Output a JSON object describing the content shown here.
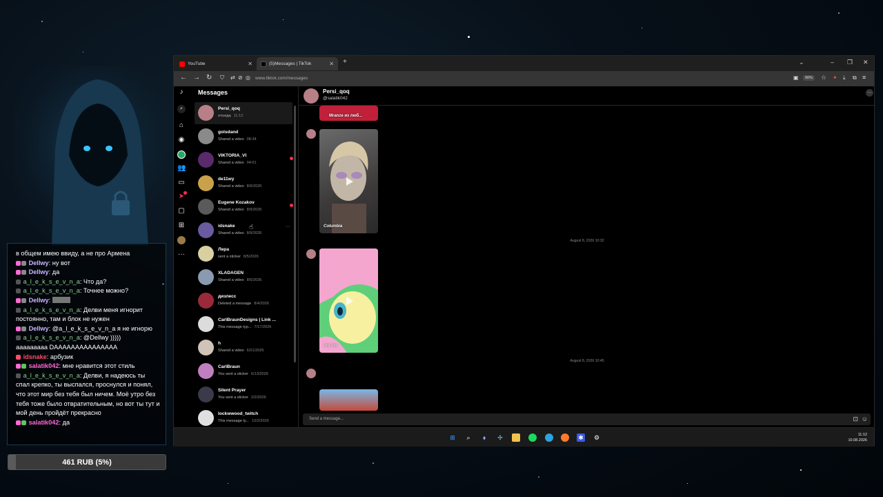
{
  "chat_overlay": {
    "messages": [
      {
        "user": "",
        "text": "в общем имею ввиду, а не про Армена",
        "color": "#ffffff"
      },
      {
        "user": "Dellwy",
        "text": "ну вот",
        "color": "#c9b6ff"
      },
      {
        "user": "Dellwy",
        "text": "да",
        "color": "#c9b6ff"
      },
      {
        "user": "a_l_e_k_s_e_v_n_a",
        "text": "Что да?",
        "color": "#8fd18f"
      },
      {
        "user": "a_l_e_k_s_e_v_n_a",
        "text": "Точнее можно?",
        "color": "#8fd18f"
      },
      {
        "user": "Dellwy",
        "text": "",
        "color": "#c9b6ff"
      },
      {
        "user": "a_l_e_k_s_e_v_n_a",
        "text": "Делви меня игнорит постоянно, там и блок не нужен",
        "color": "#8fd18f"
      },
      {
        "user": "Dellwy",
        "text": "@a_l_e_k_s_e_v_n_a я не игнорю",
        "color": "#c9b6ff"
      },
      {
        "user": "a_l_e_k_s_e_v_n_a",
        "text": "@Dellwy )))))",
        "color": "#8fd18f"
      },
      {
        "user": "",
        "text": "ааааааааа DAAAAAAAAAAAAAAA",
        "color": "#ffffff"
      },
      {
        "user": "idsnake",
        "text": "арбузик",
        "color": "#ff4d6a"
      },
      {
        "user": "salatik042",
        "text": "мне нравится этот стиль",
        "color": "#ff6ad5"
      },
      {
        "user": "a_l_e_k_s_e_v_n_a",
        "text": "Делви, я надеюсь ты спал крепко, ты выспался, проснулся и понял, что этот мир без тебя был ничем. Моё утро без тебя тоже было отвратительным, но вот ты тут и мой день пройдёт прекрасно",
        "color": "#8fd18f"
      },
      {
        "user": "salatik042",
        "text": "да",
        "color": "#ff6ad5"
      }
    ]
  },
  "donation": {
    "label": "461 RUB (5%)",
    "progress_percent": 5
  },
  "browser": {
    "tabs": [
      {
        "label": "YouTube",
        "favicon_color": "#ff0000",
        "active": false
      },
      {
        "label": "(5)Messages | TikTok",
        "favicon_color": "#000000",
        "active": true
      }
    ],
    "new_tab": "+",
    "url": "www.tiktok.com/messages",
    "zoom": "90%",
    "window_controls": {
      "minimize": "–",
      "maximize": "❐",
      "close": "✕"
    }
  },
  "tiktok": {
    "messages_title": "Messages",
    "conversations": [
      {
        "name": "Persi_qoq",
        "preview": "отсюда",
        "time": "11:12",
        "avatar_color": "#b77f86",
        "active": true,
        "unread": false
      },
      {
        "name": "golsdand",
        "preview": "Shared a video",
        "time": "08:34",
        "avatar_color": "#8a8a8a",
        "active": false,
        "unread": false
      },
      {
        "name": "VIKTORIA_VI",
        "preview": "Shared a video",
        "time": "04:01",
        "avatar_color": "#5a2a6a",
        "active": false,
        "unread": true
      },
      {
        "name": "de11wy",
        "preview": "Shared a video",
        "time": "8/9/2026",
        "avatar_color": "#c9a14a",
        "active": false,
        "unread": false
      },
      {
        "name": "Eugene Kozakov",
        "preview": "Shared a video",
        "time": "8/9/2026",
        "avatar_color": "#5a5a5a",
        "active": false,
        "unread": true
      },
      {
        "name": "idsnake",
        "preview": "Shared a video",
        "time": "8/9/2026",
        "avatar_color": "#6a5aa0",
        "active": false,
        "unread": false
      },
      {
        "name": "Лера",
        "preview": "sent a sticker",
        "time": "8/5/2026",
        "avatar_color": "#d8d0a0",
        "active": false,
        "unread": false
      },
      {
        "name": "XLADAGEN",
        "preview": "Shared a video",
        "time": "8/5/2026",
        "avatar_color": "#8a9ab0",
        "active": false,
        "unread": false
      },
      {
        "name": "дизлесс",
        "preview": "Deleted a message",
        "time": "8/4/2026",
        "avatar_color": "#9a2a3a",
        "active": false,
        "unread": false
      },
      {
        "name": "CarlBraunDesigns | Link ...",
        "preview": "This message typ...",
        "time": "7/17/2026",
        "avatar_color": "#dcdcdc",
        "active": false,
        "unread": false
      },
      {
        "name": "h",
        "preview": "Shared a video",
        "time": "6/21/2026",
        "avatar_color": "#d0c4b8",
        "active": false,
        "unread": false
      },
      {
        "name": "CarlBraun",
        "preview": "You sent a sticker",
        "time": "5/13/2026",
        "avatar_color": "#c080c0",
        "active": false,
        "unread": false
      },
      {
        "name": "Silent Prayer",
        "preview": "You sent a sticker",
        "time": "2/2/2026",
        "avatar_color": "#3a3a4a",
        "active": false,
        "unread": false
      },
      {
        "name": "lockwwood_twitch",
        "preview": "This message ty...",
        "time": "12/2/2025",
        "avatar_color": "#e0e0e0",
        "active": false,
        "unread": false
      }
    ],
    "chat": {
      "name": "Persi_qoq",
      "handle": "@salatik042",
      "top_card_caption": "Mranze из люб...",
      "video1_caption": "Columbia",
      "video2_caption": "что это",
      "date_1": "August 8, 2026 10:32",
      "date_2": "August 8, 2026 10:45",
      "composer_placeholder": "Send a message..."
    }
  },
  "taskbar": {
    "time": "11:12",
    "date": "10.08.2026"
  }
}
